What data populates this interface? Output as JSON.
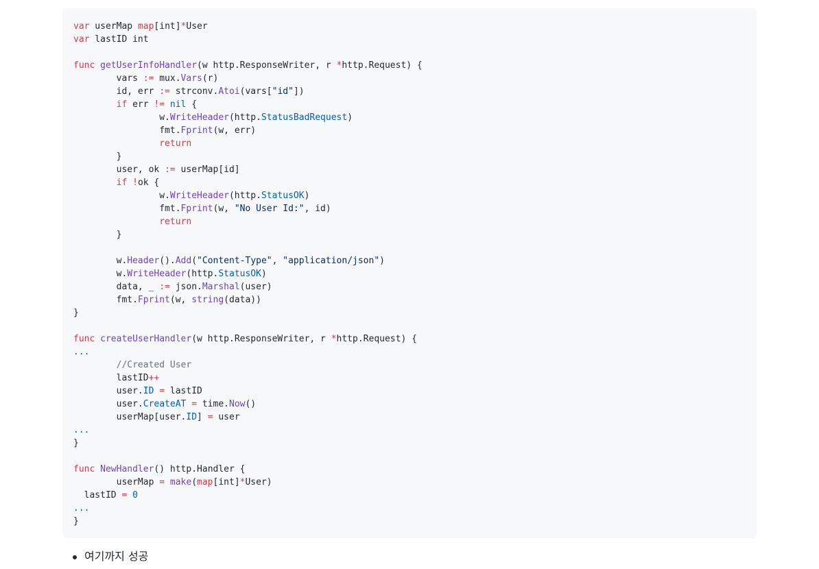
{
  "code": {
    "language": "go",
    "colors": {
      "plain": "#24292e",
      "keyword": "#d73a49",
      "func": "#6f42c1",
      "const": "#005cc5",
      "string": "#032f62",
      "comment": "#6a737d",
      "background": "#f6f8fa"
    },
    "lines": [
      [
        [
          "keyword",
          "var"
        ],
        [
          "plain",
          " userMap "
        ],
        [
          "keyword",
          "map"
        ],
        [
          "plain",
          "[int]"
        ],
        [
          "keyword",
          "*"
        ],
        [
          "plain",
          "User"
        ]
      ],
      [
        [
          "keyword",
          "var"
        ],
        [
          "plain",
          " lastID int"
        ]
      ],
      [],
      [
        [
          "keyword",
          "func"
        ],
        [
          "plain",
          " "
        ],
        [
          "func",
          "getUserInfoHandler"
        ],
        [
          "plain",
          "(w http.ResponseWriter, r "
        ],
        [
          "keyword",
          "*"
        ],
        [
          "plain",
          "http.Request) {"
        ]
      ],
      [
        [
          "plain",
          "        vars "
        ],
        [
          "keyword",
          ":="
        ],
        [
          "plain",
          " mux."
        ],
        [
          "func",
          "Vars"
        ],
        [
          "plain",
          "(r)"
        ]
      ],
      [
        [
          "plain",
          "        id, err "
        ],
        [
          "keyword",
          ":="
        ],
        [
          "plain",
          " strconv."
        ],
        [
          "func",
          "Atoi"
        ],
        [
          "plain",
          "(vars["
        ],
        [
          "string",
          "\"id\""
        ],
        [
          "plain",
          "])"
        ]
      ],
      [
        [
          "plain",
          "        "
        ],
        [
          "keyword",
          "if"
        ],
        [
          "plain",
          " err "
        ],
        [
          "keyword",
          "!="
        ],
        [
          "plain",
          " "
        ],
        [
          "const",
          "nil"
        ],
        [
          "plain",
          " {"
        ]
      ],
      [
        [
          "plain",
          "                w."
        ],
        [
          "func",
          "WriteHeader"
        ],
        [
          "plain",
          "(http."
        ],
        [
          "const",
          "StatusBadRequest"
        ],
        [
          "plain",
          ")"
        ]
      ],
      [
        [
          "plain",
          "                fmt."
        ],
        [
          "func",
          "Fprint"
        ],
        [
          "plain",
          "(w, err)"
        ]
      ],
      [
        [
          "plain",
          "                "
        ],
        [
          "keyword",
          "return"
        ]
      ],
      [
        [
          "plain",
          "        }"
        ]
      ],
      [
        [
          "plain",
          "        user, ok "
        ],
        [
          "keyword",
          ":="
        ],
        [
          "plain",
          " userMap[id]"
        ]
      ],
      [
        [
          "plain",
          "        "
        ],
        [
          "keyword",
          "if"
        ],
        [
          "plain",
          " "
        ],
        [
          "keyword",
          "!"
        ],
        [
          "plain",
          "ok {"
        ]
      ],
      [
        [
          "plain",
          "                w."
        ],
        [
          "func",
          "WriteHeader"
        ],
        [
          "plain",
          "(http."
        ],
        [
          "const",
          "StatusOK"
        ],
        [
          "plain",
          ")"
        ]
      ],
      [
        [
          "plain",
          "                fmt."
        ],
        [
          "func",
          "Fprint"
        ],
        [
          "plain",
          "(w, "
        ],
        [
          "string",
          "\"No User Id:\""
        ],
        [
          "plain",
          ", id)"
        ]
      ],
      [
        [
          "plain",
          "                "
        ],
        [
          "keyword",
          "return"
        ]
      ],
      [
        [
          "plain",
          "        }"
        ]
      ],
      [],
      [
        [
          "plain",
          "        w."
        ],
        [
          "func",
          "Header"
        ],
        [
          "plain",
          "()."
        ],
        [
          "func",
          "Add"
        ],
        [
          "plain",
          "("
        ],
        [
          "string",
          "\"Content-Type\""
        ],
        [
          "plain",
          ", "
        ],
        [
          "string",
          "\"application/json\""
        ],
        [
          "plain",
          ")"
        ]
      ],
      [
        [
          "plain",
          "        w."
        ],
        [
          "func",
          "WriteHeader"
        ],
        [
          "plain",
          "(http."
        ],
        [
          "const",
          "StatusOK"
        ],
        [
          "plain",
          ")"
        ]
      ],
      [
        [
          "plain",
          "        data, _ "
        ],
        [
          "keyword",
          ":="
        ],
        [
          "plain",
          " json."
        ],
        [
          "func",
          "Marshal"
        ],
        [
          "plain",
          "(user)"
        ]
      ],
      [
        [
          "plain",
          "        fmt."
        ],
        [
          "func",
          "Fprint"
        ],
        [
          "plain",
          "(w, "
        ],
        [
          "func",
          "string"
        ],
        [
          "plain",
          "(data))"
        ]
      ],
      [
        [
          "plain",
          "}"
        ]
      ],
      [],
      [
        [
          "keyword",
          "func"
        ],
        [
          "plain",
          " "
        ],
        [
          "func",
          "createUserHandler"
        ],
        [
          "plain",
          "(w http.ResponseWriter, r "
        ],
        [
          "keyword",
          "*"
        ],
        [
          "plain",
          "http.Request) {"
        ]
      ],
      [
        [
          "const",
          "..."
        ]
      ],
      [
        [
          "comment",
          "        //Created User"
        ]
      ],
      [
        [
          "plain",
          "        lastID"
        ],
        [
          "keyword",
          "++"
        ]
      ],
      [
        [
          "plain",
          "        user."
        ],
        [
          "const",
          "ID"
        ],
        [
          "plain",
          " "
        ],
        [
          "keyword",
          "="
        ],
        [
          "plain",
          " lastID"
        ]
      ],
      [
        [
          "plain",
          "        user."
        ],
        [
          "const",
          "CreateAT"
        ],
        [
          "plain",
          " "
        ],
        [
          "keyword",
          "="
        ],
        [
          "plain",
          " time."
        ],
        [
          "func",
          "Now"
        ],
        [
          "plain",
          "()"
        ]
      ],
      [
        [
          "plain",
          "        userMap[user."
        ],
        [
          "const",
          "ID"
        ],
        [
          "plain",
          "] "
        ],
        [
          "keyword",
          "="
        ],
        [
          "plain",
          " user"
        ]
      ],
      [
        [
          "const",
          "..."
        ]
      ],
      [
        [
          "plain",
          "}"
        ]
      ],
      [],
      [
        [
          "keyword",
          "func"
        ],
        [
          "plain",
          " "
        ],
        [
          "func",
          "NewHandler"
        ],
        [
          "plain",
          "() http.Handler {"
        ]
      ],
      [
        [
          "plain",
          "        userMap "
        ],
        [
          "keyword",
          "="
        ],
        [
          "plain",
          " "
        ],
        [
          "func",
          "make"
        ],
        [
          "plain",
          "("
        ],
        [
          "keyword",
          "map"
        ],
        [
          "plain",
          "[int]"
        ],
        [
          "keyword",
          "*"
        ],
        [
          "plain",
          "User)"
        ]
      ],
      [
        [
          "plain",
          "  lastID "
        ],
        [
          "keyword",
          "="
        ],
        [
          "plain",
          " "
        ],
        [
          "const",
          "0"
        ]
      ],
      [
        [
          "const",
          "..."
        ]
      ],
      [
        [
          "plain",
          "}"
        ]
      ]
    ]
  },
  "bullets": [
    {
      "text": "여기까지 성공"
    }
  ]
}
